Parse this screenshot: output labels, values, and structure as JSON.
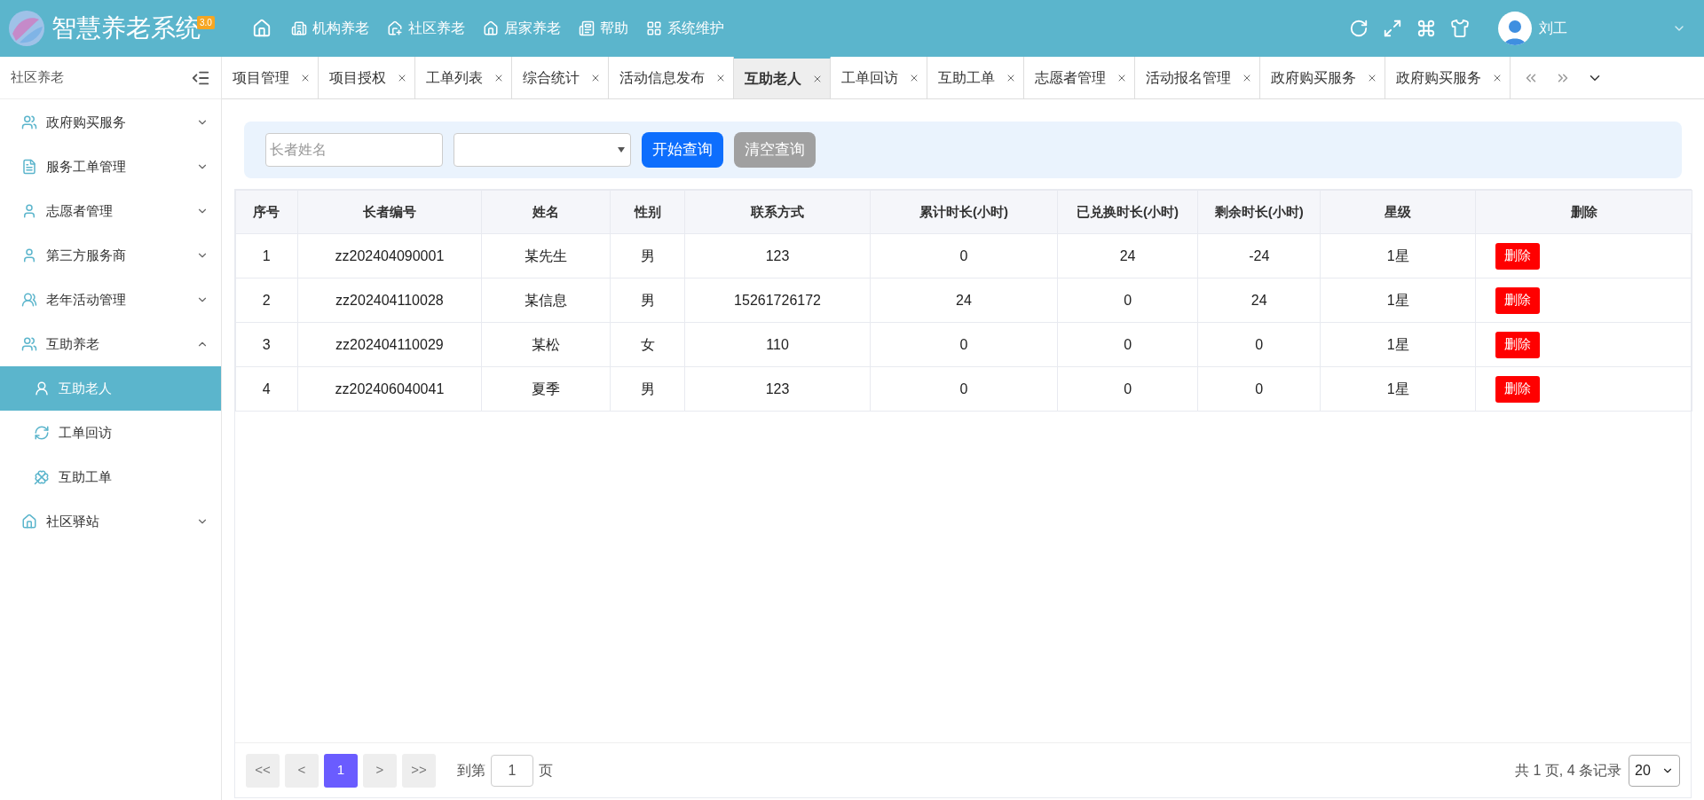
{
  "header": {
    "logo_text": "智慧养老系统",
    "version_badge": "3.0",
    "nav": [
      {
        "label": "机构养老"
      },
      {
        "label": "社区养老"
      },
      {
        "label": "居家养老"
      },
      {
        "label": "帮助"
      },
      {
        "label": "系统维护"
      }
    ],
    "user": "刘工"
  },
  "sidebar": {
    "title": "社区养老",
    "items": [
      {
        "label": "政府购买服务",
        "selected": false,
        "expanded": false
      },
      {
        "label": "服务工单管理",
        "selected": false,
        "expanded": false
      },
      {
        "label": "志愿者管理",
        "selected": false,
        "expanded": false
      },
      {
        "label": "第三方服务商",
        "selected": false,
        "expanded": false
      },
      {
        "label": "老年活动管理",
        "selected": false,
        "expanded": false
      },
      {
        "label": "互助养老",
        "selected": false,
        "expanded": true,
        "children": [
          {
            "label": "互助老人",
            "selected": true
          },
          {
            "label": "工单回访",
            "selected": false
          },
          {
            "label": "互助工单",
            "selected": false
          }
        ]
      },
      {
        "label": "社区驿站",
        "selected": false,
        "expanded": false
      }
    ]
  },
  "tabs": [
    {
      "label": "项目管理",
      "selected": false
    },
    {
      "label": "项目授权",
      "selected": false
    },
    {
      "label": "工单列表",
      "selected": false
    },
    {
      "label": "综合统计",
      "selected": false
    },
    {
      "label": "活动信息发布",
      "selected": false
    },
    {
      "label": "互助老人",
      "selected": true
    },
    {
      "label": "工单回访",
      "selected": false
    },
    {
      "label": "互助工单",
      "selected": false
    },
    {
      "label": "志愿者管理",
      "selected": false
    },
    {
      "label": "活动报名管理",
      "selected": false
    },
    {
      "label": "政府购买服务",
      "selected": false
    },
    {
      "label": "政府购买服务",
      "selected": false
    }
  ],
  "search": {
    "placeholder": "长者姓名",
    "buttons": [
      "开始查询",
      "清空查询"
    ]
  },
  "table": {
    "columns": [
      "序号",
      "长者编号",
      "姓名",
      "性别",
      "联系方式",
      "累计时长(小时)",
      "已兑换时长(小时)",
      "剩余时长(小时)",
      "星级",
      "删除"
    ],
    "rows": [
      {
        "cells": [
          "1",
          "zz202404090001",
          "某先生",
          "男",
          "123",
          "0",
          "24",
          "-24",
          "1星"
        ],
        "action": "删除"
      },
      {
        "cells": [
          "2",
          "zz202404110028",
          "某信息",
          "男",
          "15261726172",
          "24",
          "0",
          "24",
          "1星"
        ],
        "action": "删除"
      },
      {
        "cells": [
          "3",
          "zz202404110029",
          "某松",
          "女",
          "110",
          "0",
          "0",
          "0",
          "1星"
        ],
        "action": "删除"
      },
      {
        "cells": [
          "4",
          "zz202406040041",
          "夏季",
          "男",
          "123",
          "0",
          "0",
          "0",
          "1星"
        ],
        "action": "删除"
      }
    ]
  },
  "pagination": {
    "pages": [
      {
        "label": "<<",
        "selected": false
      },
      {
        "label": "<",
        "selected": false
      },
      {
        "label": "1",
        "selected": true
      },
      {
        "label": ">",
        "selected": false
      },
      {
        "label": ">>",
        "selected": false
      }
    ],
    "goto_prefix": "到第",
    "goto_value": "1",
    "goto_suffix": "页",
    "summary": "共 1 页, 4 条记录",
    "page_size": "20"
  }
}
